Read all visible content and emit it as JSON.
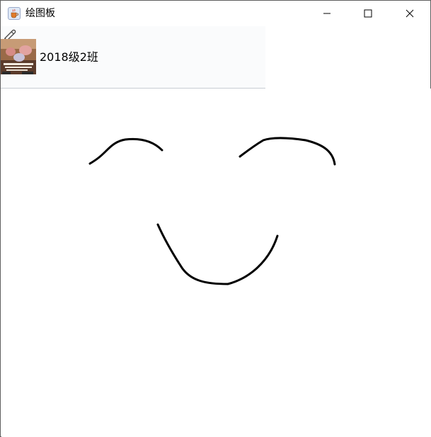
{
  "window": {
    "title": "绘图板",
    "app_icon": "java-cup-icon",
    "controls": {
      "minimize_icon": "minimize-icon",
      "maximize_icon": "maximize-icon",
      "close_icon": "close-icon"
    }
  },
  "toolbar": {
    "pencil_icon": "pencil-icon",
    "avatar_icon": "class-photo-thumbnail",
    "class_label": "2018级2班"
  },
  "canvas": {
    "stroke_color": "#000000",
    "background_color": "#ffffff",
    "strokes": [
      {
        "name": "left-eyebrow-stroke"
      },
      {
        "name": "right-eyebrow-stroke"
      },
      {
        "name": "smile-stroke"
      }
    ]
  }
}
